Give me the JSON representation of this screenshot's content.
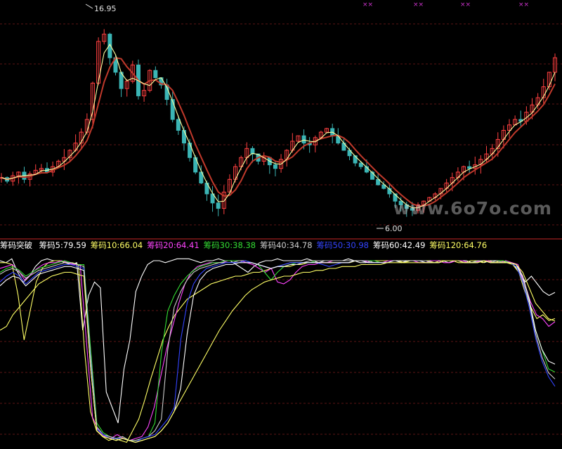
{
  "watermark": "www.6o7o.com",
  "price_panel": {
    "high_label": "16.95",
    "low_label": "6.00",
    "marker_glyph": "××",
    "marker_color": "#cc33cc",
    "up_color": "#ff4040",
    "down_color": "#3bb5b5",
    "ma_fast_color": "#ffffa0",
    "ma_slow_color": "#c0392b"
  },
  "indicator": {
    "title": "筹码突破",
    "title_color": "#ffffff",
    "legend": [
      {
        "label": "筹码5:79.59",
        "color": "#ffffff"
      },
      {
        "label": "筹码10:66.04",
        "color": "#ffff66"
      },
      {
        "label": "筹码20:64.41",
        "color": "#ff44ff"
      },
      {
        "label": "筹码30:38.38",
        "color": "#33dd33"
      },
      {
        "label": "筹码40:34.78",
        "color": "#cccccc"
      },
      {
        "label": "筹码50:30.98",
        "color": "#3344ff"
      },
      {
        "label": "筹码60:42.49",
        "color": "#ffffff"
      },
      {
        "label": "筹码120:64.76",
        "color": "#ffff66"
      }
    ]
  },
  "chart_data": {
    "type": "line",
    "title": "",
    "ylim_price": [
      5.5,
      17.5
    ],
    "annotations": [
      {
        "text": "16.95",
        "kind": "high"
      },
      {
        "text": "6.00",
        "kind": "low"
      }
    ],
    "close": [
      8.3,
      8.1,
      8.4,
      8.6,
      8.2,
      8.5,
      8.7,
      8.8,
      8.6,
      8.9,
      9.2,
      9.4,
      9.8,
      10.2,
      10.8,
      11.5,
      13.5,
      15.8,
      16.2,
      14.9,
      14.1,
      13.2,
      13.6,
      14.5,
      12.8,
      13.1,
      14.2,
      13.8,
      13.4,
      12.6,
      11.5,
      10.9,
      10.2,
      9.4,
      8.6,
      8.0,
      7.4,
      6.9,
      6.6,
      7.5,
      8.2,
      8.9,
      9.4,
      9.9,
      9.6,
      9.2,
      9.4,
      9.0,
      8.8,
      9.3,
      9.8,
      10.3,
      10.6,
      10.2,
      10.1,
      10.5,
      10.8,
      11.0,
      10.6,
      10.2,
      9.8,
      9.5,
      9.1,
      8.9,
      8.6,
      8.2,
      7.9,
      7.7,
      7.4,
      7.0,
      6.8,
      6.6,
      6.5,
      6.8,
      7.0,
      7.2,
      7.4,
      7.7,
      8.0,
      8.3,
      8.6,
      8.9,
      8.8,
      9.0,
      9.3,
      9.6,
      9.9,
      10.4,
      10.9,
      11.2,
      11.5,
      11.4,
      11.9,
      12.3,
      12.7,
      13.3,
      14.1,
      14.9
    ],
    "series": [
      {
        "name": "筹码5",
        "color": "#ffffff",
        "values": [
          96,
          95,
          97,
          90,
          85,
          88,
          93,
          96,
          97,
          96,
          96,
          95,
          94,
          95,
          60,
          78,
          85,
          82,
          28,
          20,
          12,
          40,
          55,
          80,
          88,
          94,
          96,
          96,
          95,
          96,
          97,
          97,
          97,
          96,
          95,
          96,
          96,
          97,
          96,
          96,
          94,
          92,
          90,
          93,
          95,
          96,
          96,
          97,
          96,
          96,
          96,
          96,
          97,
          96,
          95,
          96,
          96,
          96,
          96,
          97,
          96,
          95,
          95,
          96,
          96,
          96,
          96,
          96,
          95,
          96,
          96,
          96,
          96,
          96,
          96,
          96,
          95,
          96,
          96,
          96,
          95,
          96,
          95,
          96,
          96,
          96,
          95,
          94,
          90,
          85,
          88,
          84,
          80,
          78,
          79.59
        ]
      },
      {
        "name": "筹码10",
        "color": "#ffff66",
        "values": [
          95,
          95,
          94,
          78,
          55,
          70,
          85,
          92,
          95,
          96,
          96,
          95,
          95,
          94,
          50,
          18,
          8,
          5,
          3,
          4,
          3,
          2,
          8,
          14,
          24,
          35,
          45,
          55,
          62,
          68,
          72,
          76,
          78,
          80,
          82,
          84,
          85,
          86,
          87,
          88,
          88,
          89,
          90,
          90,
          91,
          92,
          93,
          93,
          93,
          94,
          94,
          95,
          95,
          95,
          95,
          95,
          95,
          95,
          95,
          96,
          96,
          96,
          96,
          96,
          96,
          96,
          96,
          95,
          96,
          96,
          96,
          96,
          95,
          96,
          96,
          96,
          95,
          95,
          96,
          96,
          95,
          96,
          95,
          96,
          95,
          94,
          90,
          80,
          72,
          66,
          68,
          65,
          66.04
        ]
      },
      {
        "name": "筹码20",
        "color": "#ff44ff",
        "values": [
          92,
          93,
          94,
          91,
          86,
          89,
          92,
          94,
          95,
          95,
          96,
          95,
          94,
          94,
          55,
          15,
          8,
          5,
          4,
          6,
          4,
          3,
          4,
          5,
          10,
          20,
          35,
          50,
          62,
          74,
          84,
          90,
          93,
          94,
          95,
          95,
          95,
          96,
          96,
          96,
          95,
          94,
          92,
          90,
          92,
          85,
          84,
          86,
          90,
          93,
          94,
          94,
          95,
          95,
          96,
          96,
          96,
          96,
          96,
          96,
          95,
          95,
          95,
          96,
          96,
          96,
          96,
          96,
          95,
          95,
          96,
          96,
          95,
          95,
          96,
          96,
          95,
          95,
          96,
          96,
          95,
          95,
          96,
          95,
          94,
          85,
          75,
          68,
          66,
          62,
          64.41
        ]
      },
      {
        "name": "筹码30",
        "color": "#33dd33",
        "values": [
          90,
          92,
          93,
          91,
          88,
          90,
          92,
          93,
          94,
          95,
          96,
          95,
          94,
          94,
          52,
          12,
          7,
          5,
          4,
          5,
          3,
          3,
          4,
          5,
          12,
          48,
          70,
          78,
          84,
          88,
          91,
          93,
          94,
          95,
          95,
          96,
          96,
          96,
          96,
          95,
          94,
          90,
          86,
          90,
          93,
          94,
          95,
          95,
          95,
          96,
          96,
          96,
          96,
          96,
          96,
          96,
          96,
          96,
          96,
          95,
          95,
          96,
          96,
          96,
          96,
          96,
          96,
          95,
          95,
          96,
          96,
          96,
          95,
          95,
          96,
          96,
          95,
          96,
          96,
          95,
          94,
          85,
          75,
          60,
          50,
          40,
          38.38
        ]
      },
      {
        "name": "筹码40",
        "color": "#cccccc",
        "values": [
          89,
          91,
          92,
          90,
          87,
          89,
          91,
          92,
          93,
          94,
          95,
          95,
          94,
          93,
          48,
          10,
          6,
          5,
          4,
          5,
          3,
          3,
          4,
          5,
          8,
          14,
          50,
          72,
          80,
          86,
          90,
          92,
          93,
          94,
          95,
          95,
          95,
          96,
          96,
          95,
          94,
          93,
          92,
          93,
          94,
          95,
          95,
          95,
          96,
          96,
          96,
          96,
          96,
          96,
          96,
          96,
          96,
          96,
          95,
          95,
          95,
          96,
          96,
          96,
          96,
          96,
          96,
          95,
          95,
          96,
          96,
          96,
          95,
          95,
          96,
          96,
          95,
          96,
          95,
          95,
          94,
          86,
          74,
          58,
          46,
          38,
          34.78
        ]
      },
      {
        "name": "筹码50",
        "color": "#3344ff",
        "values": [
          85,
          88,
          90,
          88,
          84,
          87,
          90,
          91,
          92,
          93,
          94,
          94,
          93,
          92,
          45,
          9,
          6,
          4,
          4,
          4,
          3,
          2,
          4,
          5,
          6,
          10,
          14,
          20,
          55,
          74,
          84,
          89,
          92,
          93,
          94,
          95,
          95,
          95,
          96,
          95,
          94,
          93,
          92,
          93,
          94,
          95,
          95,
          95,
          95,
          95,
          94,
          93,
          94,
          95,
          95,
          96,
          96,
          95,
          95,
          95,
          95,
          96,
          96,
          96,
          96,
          96,
          95,
          95,
          95,
          96,
          96,
          96,
          95,
          95,
          95,
          96,
          95,
          95,
          95,
          95,
          93,
          85,
          72,
          56,
          44,
          36,
          30.98
        ]
      },
      {
        "name": "筹码60",
        "color": "#ffffff",
        "values": [
          83,
          86,
          88,
          87,
          83,
          86,
          89,
          90,
          91,
          92,
          93,
          93,
          92,
          91,
          42,
          8,
          5,
          4,
          3,
          4,
          3,
          2,
          3,
          4,
          5,
          8,
          12,
          18,
          30,
          58,
          78,
          86,
          90,
          92,
          93,
          94,
          94,
          95,
          95,
          95,
          94,
          93,
          92,
          93,
          93,
          94,
          94,
          95,
          95,
          95,
          95,
          95,
          95,
          95,
          95,
          96,
          96,
          95,
          95,
          95,
          95,
          96,
          96,
          96,
          96,
          96,
          95,
          95,
          95,
          96,
          96,
          96,
          95,
          95,
          95,
          96,
          95,
          95,
          95,
          95,
          94,
          88,
          76,
          60,
          50,
          44,
          42.49
        ]
      },
      {
        "name": "筹码120",
        "color": "#ffff66",
        "values": [
          60,
          62,
          68,
          72,
          76,
          80,
          84,
          86,
          88,
          89,
          90,
          90,
          89,
          88,
          42,
          8,
          5,
          4,
          3,
          4,
          3,
          2,
          3,
          4,
          5,
          8,
          12,
          18,
          24,
          30,
          36,
          42,
          48,
          54,
          60,
          65,
          70,
          74,
          78,
          81,
          83,
          85,
          86,
          87,
          88,
          88,
          89,
          90,
          90,
          91,
          91,
          92,
          92,
          93,
          93,
          93,
          94,
          94,
          94,
          94,
          95,
          95,
          95,
          95,
          95,
          95,
          95,
          95,
          95,
          96,
          96,
          96,
          95,
          95,
          95,
          96,
          95,
          95,
          95,
          95,
          94,
          90,
          82,
          74,
          70,
          66,
          64.76
        ]
      }
    ]
  }
}
